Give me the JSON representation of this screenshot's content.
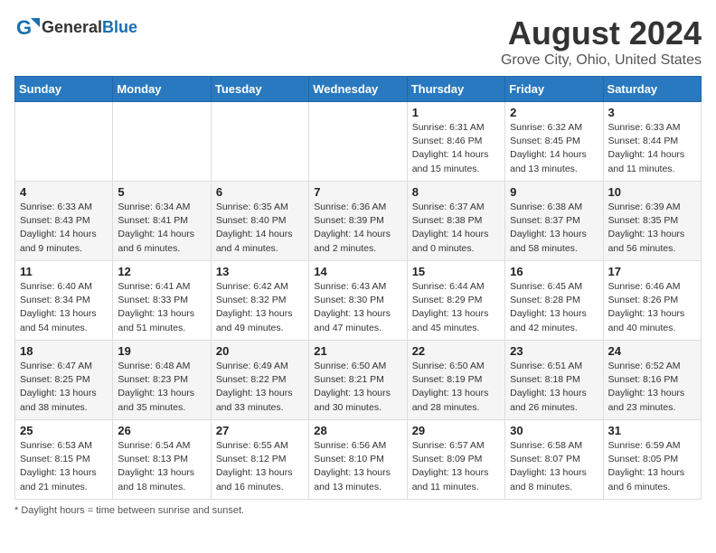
{
  "header": {
    "logo_general": "General",
    "logo_blue": "Blue",
    "title": "August 2024",
    "subtitle": "Grove City, Ohio, United States"
  },
  "days_of_week": [
    "Sunday",
    "Monday",
    "Tuesday",
    "Wednesday",
    "Thursday",
    "Friday",
    "Saturday"
  ],
  "footer": {
    "daylight_label": "Daylight hours"
  },
  "weeks": [
    [
      {
        "day": "",
        "info": ""
      },
      {
        "day": "",
        "info": ""
      },
      {
        "day": "",
        "info": ""
      },
      {
        "day": "",
        "info": ""
      },
      {
        "day": "1",
        "info": "Sunrise: 6:31 AM\nSunset: 8:46 PM\nDaylight: 14 hours\nand 15 minutes."
      },
      {
        "day": "2",
        "info": "Sunrise: 6:32 AM\nSunset: 8:45 PM\nDaylight: 14 hours\nand 13 minutes."
      },
      {
        "day": "3",
        "info": "Sunrise: 6:33 AM\nSunset: 8:44 PM\nDaylight: 14 hours\nand 11 minutes."
      }
    ],
    [
      {
        "day": "4",
        "info": "Sunrise: 6:33 AM\nSunset: 8:43 PM\nDaylight: 14 hours\nand 9 minutes."
      },
      {
        "day": "5",
        "info": "Sunrise: 6:34 AM\nSunset: 8:41 PM\nDaylight: 14 hours\nand 6 minutes."
      },
      {
        "day": "6",
        "info": "Sunrise: 6:35 AM\nSunset: 8:40 PM\nDaylight: 14 hours\nand 4 minutes."
      },
      {
        "day": "7",
        "info": "Sunrise: 6:36 AM\nSunset: 8:39 PM\nDaylight: 14 hours\nand 2 minutes."
      },
      {
        "day": "8",
        "info": "Sunrise: 6:37 AM\nSunset: 8:38 PM\nDaylight: 14 hours\nand 0 minutes."
      },
      {
        "day": "9",
        "info": "Sunrise: 6:38 AM\nSunset: 8:37 PM\nDaylight: 13 hours\nand 58 minutes."
      },
      {
        "day": "10",
        "info": "Sunrise: 6:39 AM\nSunset: 8:35 PM\nDaylight: 13 hours\nand 56 minutes."
      }
    ],
    [
      {
        "day": "11",
        "info": "Sunrise: 6:40 AM\nSunset: 8:34 PM\nDaylight: 13 hours\nand 54 minutes."
      },
      {
        "day": "12",
        "info": "Sunrise: 6:41 AM\nSunset: 8:33 PM\nDaylight: 13 hours\nand 51 minutes."
      },
      {
        "day": "13",
        "info": "Sunrise: 6:42 AM\nSunset: 8:32 PM\nDaylight: 13 hours\nand 49 minutes."
      },
      {
        "day": "14",
        "info": "Sunrise: 6:43 AM\nSunset: 8:30 PM\nDaylight: 13 hours\nand 47 minutes."
      },
      {
        "day": "15",
        "info": "Sunrise: 6:44 AM\nSunset: 8:29 PM\nDaylight: 13 hours\nand 45 minutes."
      },
      {
        "day": "16",
        "info": "Sunrise: 6:45 AM\nSunset: 8:28 PM\nDaylight: 13 hours\nand 42 minutes."
      },
      {
        "day": "17",
        "info": "Sunrise: 6:46 AM\nSunset: 8:26 PM\nDaylight: 13 hours\nand 40 minutes."
      }
    ],
    [
      {
        "day": "18",
        "info": "Sunrise: 6:47 AM\nSunset: 8:25 PM\nDaylight: 13 hours\nand 38 minutes."
      },
      {
        "day": "19",
        "info": "Sunrise: 6:48 AM\nSunset: 8:23 PM\nDaylight: 13 hours\nand 35 minutes."
      },
      {
        "day": "20",
        "info": "Sunrise: 6:49 AM\nSunset: 8:22 PM\nDaylight: 13 hours\nand 33 minutes."
      },
      {
        "day": "21",
        "info": "Sunrise: 6:50 AM\nSunset: 8:21 PM\nDaylight: 13 hours\nand 30 minutes."
      },
      {
        "day": "22",
        "info": "Sunrise: 6:50 AM\nSunset: 8:19 PM\nDaylight: 13 hours\nand 28 minutes."
      },
      {
        "day": "23",
        "info": "Sunrise: 6:51 AM\nSunset: 8:18 PM\nDaylight: 13 hours\nand 26 minutes."
      },
      {
        "day": "24",
        "info": "Sunrise: 6:52 AM\nSunset: 8:16 PM\nDaylight: 13 hours\nand 23 minutes."
      }
    ],
    [
      {
        "day": "25",
        "info": "Sunrise: 6:53 AM\nSunset: 8:15 PM\nDaylight: 13 hours\nand 21 minutes."
      },
      {
        "day": "26",
        "info": "Sunrise: 6:54 AM\nSunset: 8:13 PM\nDaylight: 13 hours\nand 18 minutes."
      },
      {
        "day": "27",
        "info": "Sunrise: 6:55 AM\nSunset: 8:12 PM\nDaylight: 13 hours\nand 16 minutes."
      },
      {
        "day": "28",
        "info": "Sunrise: 6:56 AM\nSunset: 8:10 PM\nDaylight: 13 hours\nand 13 minutes."
      },
      {
        "day": "29",
        "info": "Sunrise: 6:57 AM\nSunset: 8:09 PM\nDaylight: 13 hours\nand 11 minutes."
      },
      {
        "day": "30",
        "info": "Sunrise: 6:58 AM\nSunset: 8:07 PM\nDaylight: 13 hours\nand 8 minutes."
      },
      {
        "day": "31",
        "info": "Sunrise: 6:59 AM\nSunset: 8:05 PM\nDaylight: 13 hours\nand 6 minutes."
      }
    ]
  ]
}
